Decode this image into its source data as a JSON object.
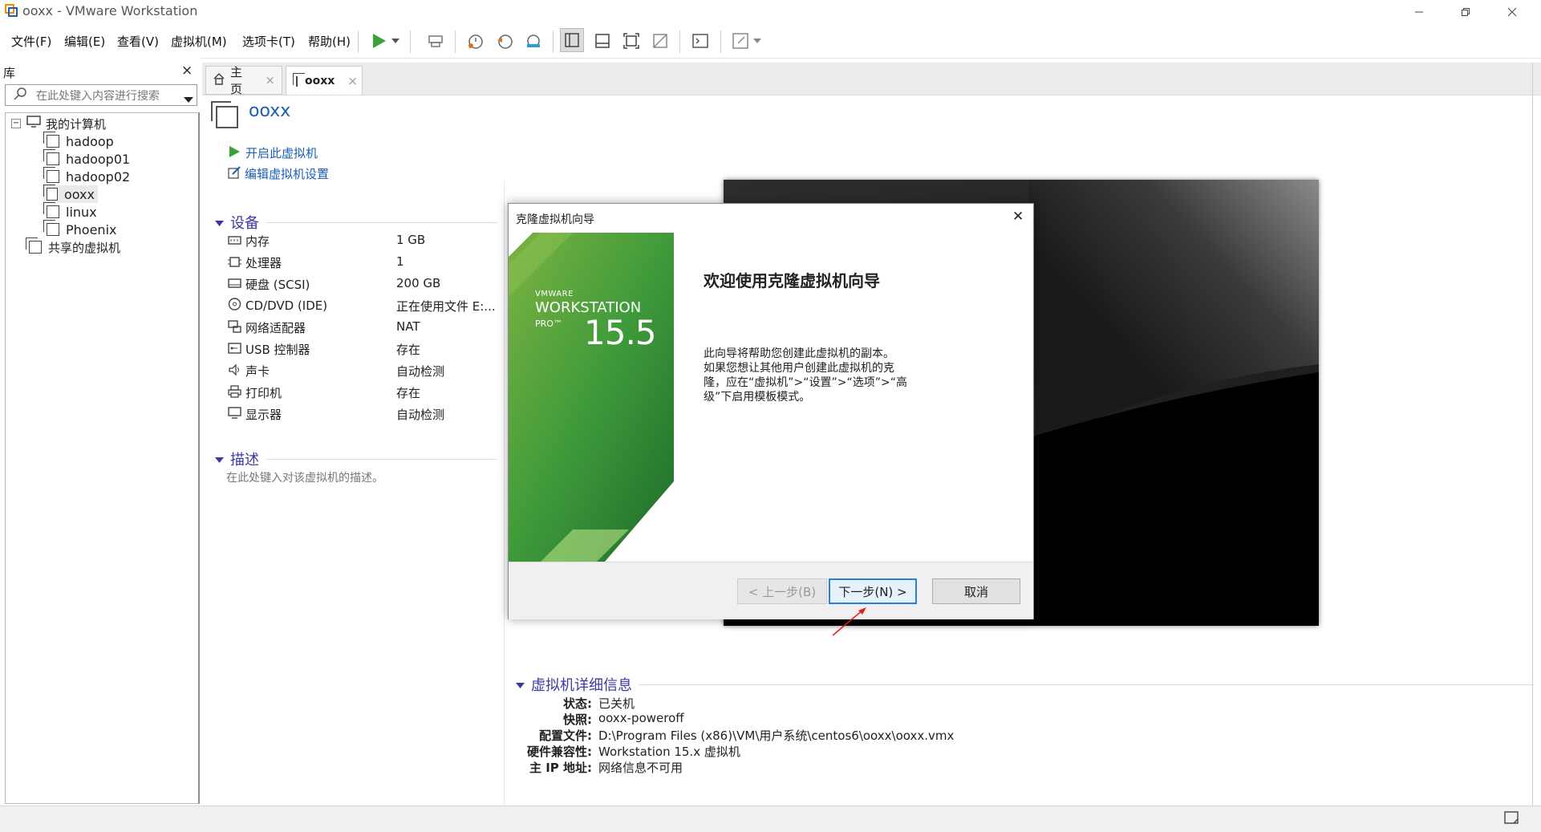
{
  "window": {
    "title": "ooxx - VMware Workstation"
  },
  "menu": [
    "文件(F)",
    "编辑(E)",
    "查看(V)",
    "虚拟机(M)",
    "选项卡(T)",
    "帮助(H)"
  ],
  "toolbar_icons": [
    "play-icon",
    "dropdown-icon",
    "send-ctrl-alt-del-icon",
    "snapshot-take-icon",
    "snapshot-revert-icon",
    "snapshot-manager-icon",
    "library-view-icon",
    "thumbnail-view-icon",
    "fullscreen-icon",
    "unity-icon",
    "console-icon",
    "stretch-icon",
    "dropdown-icon"
  ],
  "library": {
    "title": "库",
    "close": "×",
    "search_placeholder": "在此处键入内容进行搜索",
    "root": "我的计算机",
    "items": [
      "hadoop",
      "hadoop01",
      "hadoop02",
      "ooxx",
      "linux",
      "Phoenix"
    ],
    "shared": "共享的虚拟机"
  },
  "tabs": [
    {
      "label": "主页",
      "close": "×"
    },
    {
      "label": "ooxx",
      "close": "×"
    }
  ],
  "vm": {
    "name": "ooxx",
    "actions": [
      "开启此虚拟机",
      "编辑虚拟机设置"
    ]
  },
  "devices": {
    "title": "设备",
    "rows": [
      {
        "label": "内存",
        "value": "1 GB"
      },
      {
        "label": "处理器",
        "value": "1"
      },
      {
        "label": "硬盘 (SCSI)",
        "value": "200 GB"
      },
      {
        "label": "CD/DVD (IDE)",
        "value": "正在使用文件 E:..."
      },
      {
        "label": "网络适配器",
        "value": "NAT"
      },
      {
        "label": "USB 控制器",
        "value": "存在"
      },
      {
        "label": "声卡",
        "value": "自动检测"
      },
      {
        "label": "打印机",
        "value": "存在"
      },
      {
        "label": "显示器",
        "value": "自动检测"
      }
    ]
  },
  "description": {
    "title": "描述",
    "placeholder": "在此处键入对该虚拟机的描述。"
  },
  "dialog": {
    "title": "克隆虚拟机向导",
    "close": "✕",
    "brand_small": "VMWARE",
    "brand_big": "WORKSTATION",
    "brand_pro": "PRO™",
    "brand_version": "15.5",
    "heading": "欢迎使用克隆虚拟机向导",
    "body_lines": [
      "此向导将帮助您创建此虚拟机的副本。",
      "如果您想让其他用户创建此虚拟机的克",
      "隆，应在“虚拟机”>“设置”>“选项”>“高",
      "级”下启用模板模式。"
    ],
    "back_button": "< 上一步(B)",
    "next_button": "下一步(N) >",
    "cancel_button": "取消"
  },
  "details": {
    "title": "虚拟机详细信息",
    "rows": [
      {
        "key": "状态:",
        "value": "已关机"
      },
      {
        "key": "快照:",
        "value": "ooxx-poweroff"
      },
      {
        "key": "配置文件:",
        "value": "D:\\Program Files (x86)\\VM\\用户系统\\centos6\\ooxx\\ooxx.vmx"
      },
      {
        "key": "硬件兼容性:",
        "value": "Workstation 15.x 虚拟机"
      },
      {
        "key": "主 IP 地址:",
        "value": "网络信息不可用"
      }
    ]
  },
  "colors": {
    "link": "#1a5fb4",
    "section": "#3a3aa0",
    "green": "#3aa335",
    "red_arrow": "#e0201b"
  }
}
